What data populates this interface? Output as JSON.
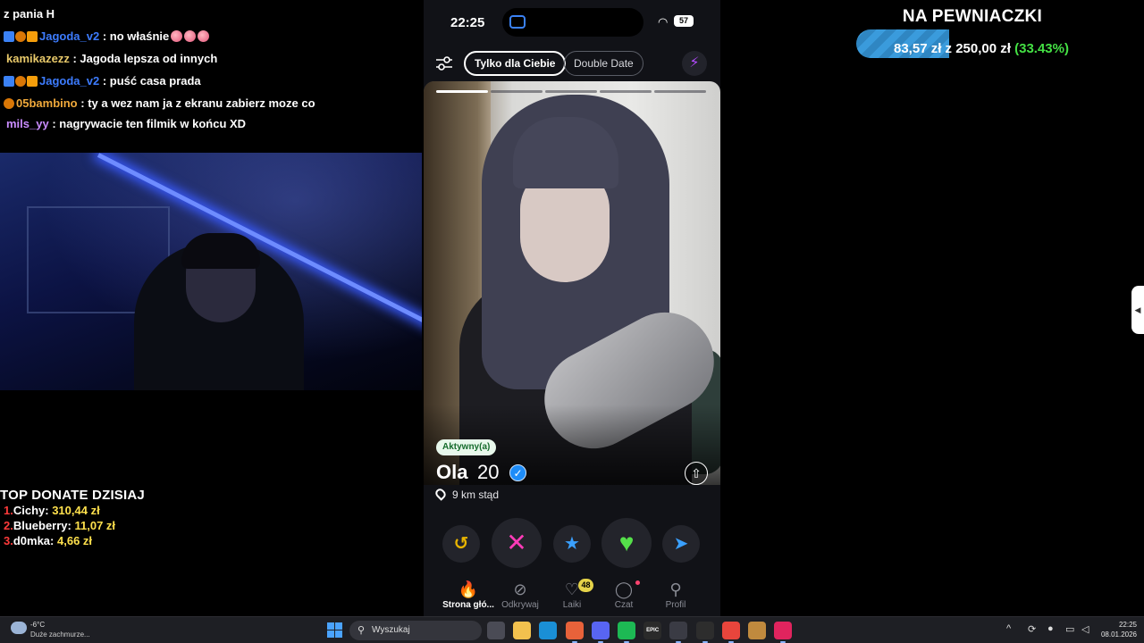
{
  "chat": [
    {
      "user": "",
      "text": "z pania H",
      "badges": false,
      "user_color": "#ffffff"
    },
    {
      "user": "Jagoda_v2",
      "text": ": no właśnie",
      "badges": true,
      "emotes": 3,
      "user_color": "#3d7cff"
    },
    {
      "user": "kamikazezz",
      "text": ": Jagoda lepsza od innych",
      "badges": false,
      "user_color": "#e8c96a"
    },
    {
      "user": "Jagoda_v2",
      "text": ": puść casa prada",
      "badges": true,
      "user_color": "#3d7cff"
    },
    {
      "user": "05bambino",
      "text": ": ty a wez nam ja z ekranu zabierz moze co",
      "badges": "one",
      "user_color": "#f0a93b"
    },
    {
      "user": "mils_yy",
      "text": ": nagrywacie ten filmik w końcu XD",
      "badges": false,
      "user_color": "#c98cff"
    }
  ],
  "top_donate": {
    "title": "TOP DONATE DZISIAJ",
    "donors": [
      {
        "rank": "1.",
        "name": "Cichy:",
        "amount": "310,44 zł"
      },
      {
        "rank": "2.",
        "name": "Blueberry:",
        "amount": "11,07 zł"
      },
      {
        "rank": "3.",
        "name": "d0mka:",
        "amount": "4,66 zł"
      }
    ]
  },
  "goal": {
    "title": "NA PEWNIACZKI",
    "current": "83,57 zł",
    "sep": "z",
    "target": "250,00 zł",
    "percent_text": "(33.43%)",
    "progress": 0.3343,
    "bar_color": "#3a9bdc",
    "percent_color": "#44e044"
  },
  "phone": {
    "status": {
      "time": "22:25",
      "battery": "57",
      "wifi_icon": "wifi-icon",
      "tv_label": "tv"
    },
    "tabs": [
      {
        "label": "Tylko dla Ciebie",
        "active": true
      },
      {
        "label": "Double Date",
        "active": false
      }
    ],
    "photo_count": 5,
    "photo_index": 0,
    "profile": {
      "active_label": "Aktywny(a)",
      "name": "Ola",
      "age": "20",
      "distance": "9 km stąd",
      "verified": true
    },
    "actions": [
      {
        "name": "rewind",
        "icon": "↺",
        "color": "#e8b400"
      },
      {
        "name": "nope",
        "icon": "✕",
        "color": "#ff3bb8"
      },
      {
        "name": "super-like",
        "icon": "★",
        "color": "#3aa0ff"
      },
      {
        "name": "like",
        "icon": "♥",
        "color": "#55e04a"
      },
      {
        "name": "boost",
        "icon": "➤",
        "color": "#3aa0ff"
      }
    ],
    "nav": [
      {
        "label": "Strona głó...",
        "icon": "flame-icon",
        "glyph": "🔥",
        "active": true
      },
      {
        "label": "Odkrywaj",
        "icon": "compass-icon",
        "glyph": "⊘",
        "active": false
      },
      {
        "label": "Laiki",
        "icon": "heart-icon",
        "glyph": "♡",
        "active": false,
        "count": "48"
      },
      {
        "label": "Czat",
        "icon": "chat-icon",
        "glyph": "◯",
        "active": false,
        "dot": true
      },
      {
        "label": "Profil",
        "icon": "profile-icon",
        "glyph": "⚲",
        "active": false
      }
    ]
  },
  "taskbar": {
    "weather_temp": "-6°C",
    "weather_desc": "Duże zachmurze...",
    "search_placeholder": "Wyszukaj",
    "time": "22:25",
    "date": "08.01.2026",
    "apps": [
      {
        "name": "task-view",
        "color": "#4a4b55"
      },
      {
        "name": "file-explorer",
        "color": "#f2c14e"
      },
      {
        "name": "edge",
        "color": "#1a8fd6"
      },
      {
        "name": "firefox",
        "color": "#e8623a"
      },
      {
        "name": "discord",
        "color": "#5865f2"
      },
      {
        "name": "spotify",
        "color": "#1db954"
      },
      {
        "name": "epic-games",
        "color": "#2a2a2a",
        "label": "EPIC"
      },
      {
        "name": "steam",
        "color": "#3a3b44"
      },
      {
        "name": "obs",
        "color": "#2d2d2d"
      },
      {
        "name": "chrome",
        "color": "#e8453c"
      },
      {
        "name": "app-bottle",
        "color": "#c08a3e"
      },
      {
        "name": "tiktok",
        "color": "#e0245e"
      }
    ]
  }
}
